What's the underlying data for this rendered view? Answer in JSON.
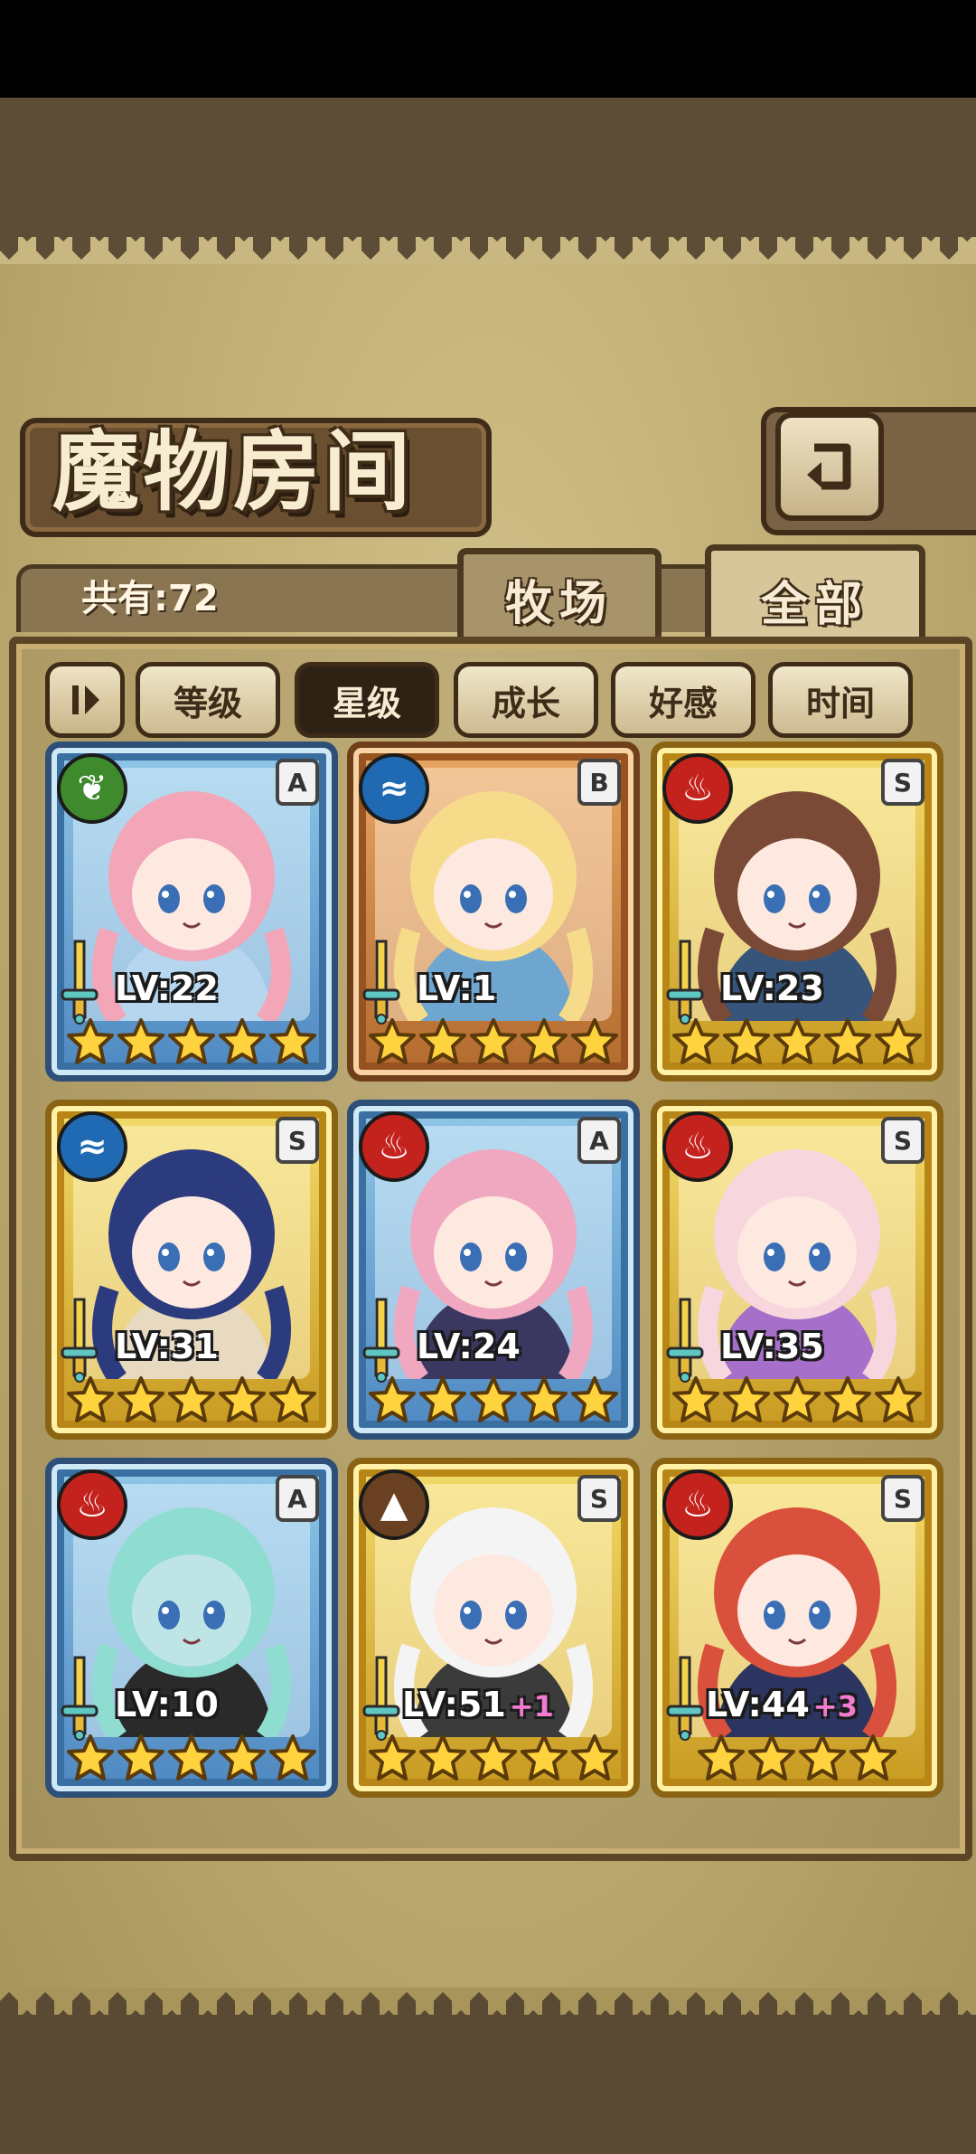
{
  "screen": {
    "title": "魔物房间",
    "total_label": "共有:72",
    "tabs": [
      {
        "label": "牧场",
        "selected": false
      },
      {
        "label": "全部",
        "selected": true
      }
    ],
    "sort_buttons": [
      {
        "label": "等级",
        "selected": false
      },
      {
        "label": "星级",
        "selected": true
      },
      {
        "label": "成长",
        "selected": false
      },
      {
        "label": "好感",
        "selected": false
      },
      {
        "label": "时间",
        "selected": false
      }
    ],
    "sort_toggle_icon": "sort-direction-icon",
    "back_icon": "return-arrow-icon"
  },
  "monsters": [
    {
      "level": "LV:22",
      "plus": "",
      "rank": "A",
      "element": "grass",
      "frame": "blue",
      "stars": 5,
      "hair": "#f2a6b8",
      "skin": "#fde9df",
      "outfit": "#b5d6ee"
    },
    {
      "level": "LV:1",
      "plus": "",
      "rank": "B",
      "element": "water",
      "frame": "bronze",
      "stars": 5,
      "hair": "#f6dc8a",
      "skin": "#fde9df",
      "outfit": "#6fa6cf"
    },
    {
      "level": "LV:23",
      "plus": "",
      "rank": "S",
      "element": "fire",
      "frame": "gold",
      "stars": 5,
      "hair": "#7a4a36",
      "skin": "#fde9df",
      "outfit": "#37557a"
    },
    {
      "level": "LV:31",
      "plus": "",
      "rank": "S",
      "element": "water",
      "frame": "gold",
      "stars": 5,
      "hair": "#2c3a7e",
      "skin": "#fde9df",
      "outfit": "#e8d9c1"
    },
    {
      "level": "LV:24",
      "plus": "",
      "rank": "A",
      "element": "fire",
      "frame": "blue",
      "stars": 5,
      "hair": "#f0a8c0",
      "skin": "#fde9df",
      "outfit": "#3a3860"
    },
    {
      "level": "LV:35",
      "plus": "",
      "rank": "S",
      "element": "fire",
      "frame": "gold",
      "stars": 5,
      "hair": "#f7d6de",
      "skin": "#fde9df",
      "outfit": "#a66fc9"
    },
    {
      "level": "LV:10",
      "plus": "",
      "rank": "A",
      "element": "fire",
      "frame": "blue",
      "stars": 5,
      "hair": "#8fdcd0",
      "skin": "#bfe4e6",
      "outfit": "#2a2a2a"
    },
    {
      "level": "LV:51",
      "plus": "+1",
      "rank": "S",
      "element": "earth",
      "frame": "gold",
      "stars": 5,
      "hair": "#f4f4f4",
      "skin": "#fde9df",
      "outfit": "#3b3b3b"
    },
    {
      "level": "LV:44",
      "plus": "+3",
      "rank": "S",
      "element": "fire",
      "frame": "gold",
      "stars": 4,
      "hair": "#d9503c",
      "skin": "#fde9df",
      "outfit": "#2c3460"
    }
  ]
}
